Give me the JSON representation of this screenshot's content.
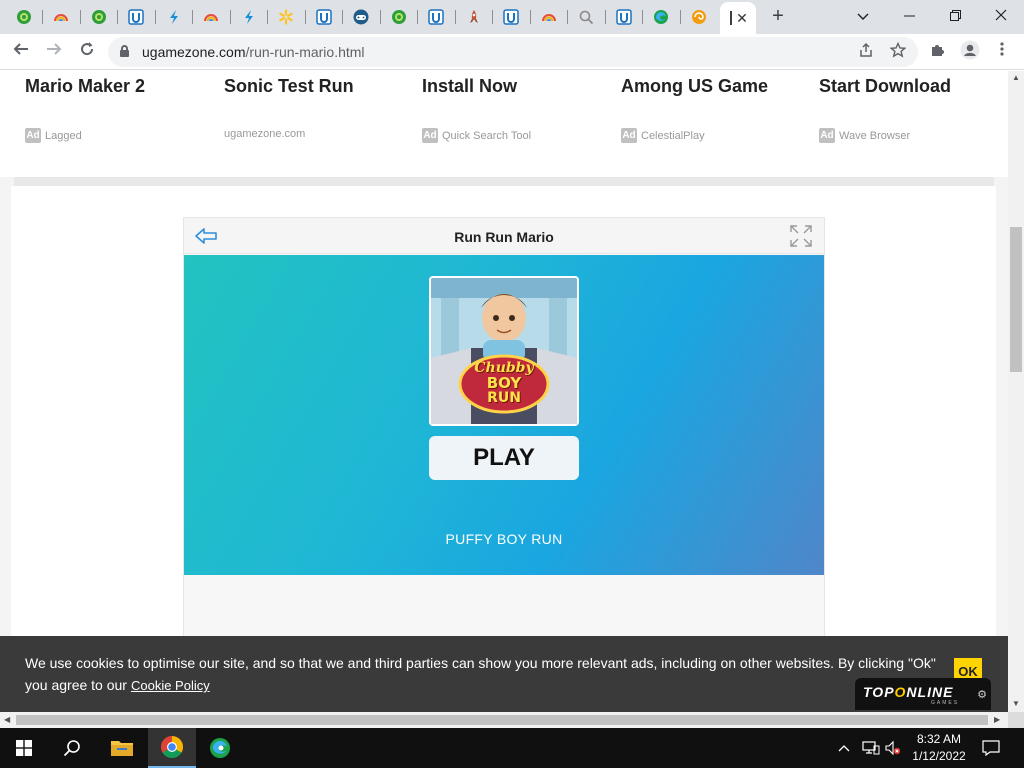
{
  "browser": {
    "tabs": [
      {
        "icon": "green-circle-icon",
        "color": "#2e9e3b"
      },
      {
        "icon": "rainbow-icon",
        "color": "#e07b2e"
      },
      {
        "icon": "green-circle-icon",
        "color": "#2e9e3b"
      },
      {
        "icon": "u-logo-icon",
        "color": "#1e73be"
      },
      {
        "icon": "lightning-icon",
        "color": "#1a8fd6"
      },
      {
        "icon": "rainbow-icon",
        "color": "#e07b2e"
      },
      {
        "icon": "lightning-icon",
        "color": "#1a8fd6"
      },
      {
        "icon": "walmart-spark-icon",
        "color": "#ffc220"
      },
      {
        "icon": "u-logo-icon",
        "color": "#1e73be"
      },
      {
        "icon": "gamepad-icon",
        "color": "#1e5c8a"
      },
      {
        "icon": "green-circle-icon",
        "color": "#2e9e3b"
      },
      {
        "icon": "u-logo-icon",
        "color": "#1e73be"
      },
      {
        "icon": "rocket-icon",
        "color": "#c0563a"
      },
      {
        "icon": "u-logo-icon",
        "color": "#1e73be"
      },
      {
        "icon": "rainbow-icon",
        "color": "#e07b2e"
      },
      {
        "icon": "search-icon",
        "color": "#888888"
      },
      {
        "icon": "u-logo-icon",
        "color": "#1e73be"
      },
      {
        "icon": "edge-icon",
        "color": "#1ba34a"
      },
      {
        "icon": "orange-swirl-icon",
        "color": "#f39c12"
      }
    ],
    "url_host": "ugamezone.com",
    "url_path": "/run-run-mario.html",
    "new_tab_symbol": "+",
    "window_controls": {
      "dropdown": "⌄",
      "minimize": "—",
      "restore": "❐",
      "close": "✕"
    }
  },
  "ads": [
    {
      "title": "Mario Maker 2",
      "source": "Lagged",
      "has_badge": true
    },
    {
      "title": "Sonic Test Run",
      "source": "ugamezone.com",
      "has_badge": false
    },
    {
      "title": "Install Now",
      "source": "Quick Search Tool",
      "has_badge": true
    },
    {
      "title": "Among US Game",
      "source": "CelestialPlay",
      "has_badge": true
    },
    {
      "title": "Start Download",
      "source": "Wave Browser",
      "has_badge": true
    }
  ],
  "ad_badge_text": "Ad",
  "game": {
    "title": "Run Run Mario",
    "play_label": "PLAY",
    "name": "PUFFY BOY RUN",
    "thumbnail_text": [
      "Chubby",
      "BOY",
      "RUN"
    ]
  },
  "cookie": {
    "text": "We use cookies to optimise our site, and so that we and third parties can show you more relevant ads, including on other websites. By clicking \"Ok\" you agree to our",
    "link": "Cookie Policy",
    "ok": "OK"
  },
  "brand": {
    "word_a": "TOP",
    "word_o": "O",
    "word_b": "NLINE",
    "sub": "GAMES"
  },
  "taskbar": {
    "time": "8:32 AM",
    "date": "1/12/2022"
  },
  "colors": {
    "accent": "#1fb6d6",
    "cookie_bg": "#3a3a3a",
    "ok": "#ffd400"
  }
}
